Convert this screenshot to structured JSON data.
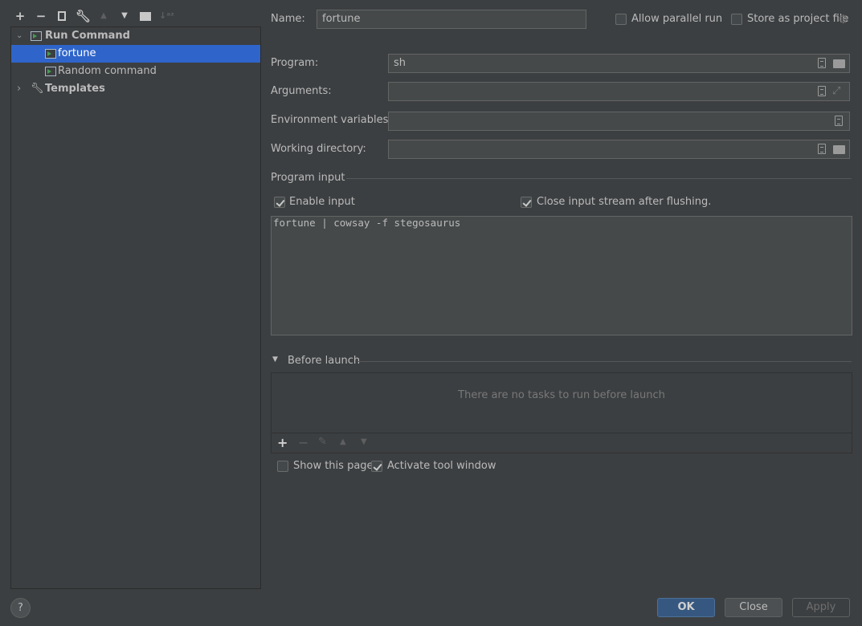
{
  "toolbar": {
    "icons": [
      "add-icon",
      "remove-icon",
      "copy-icon",
      "wrench-icon",
      "move-up-icon",
      "move-down-icon",
      "new-folder-icon",
      "sort-icon"
    ]
  },
  "tree": {
    "items": [
      {
        "label": "Run Command",
        "bold": true,
        "expanded": true
      },
      {
        "label": "fortune",
        "selected": true
      },
      {
        "label": "Random command"
      },
      {
        "label": "Templates",
        "bold": true,
        "expanded": false
      }
    ]
  },
  "form": {
    "name_label": "Name:",
    "name_value": "fortune",
    "allow_parallel_label": "Allow parallel run",
    "allow_parallel": false,
    "store_project_label": "Store as project file",
    "store_project": false,
    "program_label": "Program:",
    "program_value": "sh",
    "arguments_label": "Arguments:",
    "arguments_value": "",
    "env_label": "Environment variables:",
    "env_value": "",
    "workdir_label": "Working directory:",
    "workdir_value": "",
    "program_input_title": "Program input",
    "enable_input_label": "Enable input",
    "enable_input": true,
    "close_stream_label": "Close input stream after flushing.",
    "close_stream": true,
    "input_text": "fortune | cowsay -f stegosaurus"
  },
  "before_launch": {
    "title": "Before launch",
    "empty_text": "There are no tasks to run before launch",
    "show_page_label": "Show this page",
    "show_page": false,
    "activate_label": "Activate tool window",
    "activate": true
  },
  "buttons": {
    "help": "?",
    "ok": "OK",
    "close": "Close",
    "apply": "Apply"
  },
  "colors": {
    "background": "#3c3f41",
    "selection": "#2f65ca",
    "ok_button": "#365880"
  }
}
